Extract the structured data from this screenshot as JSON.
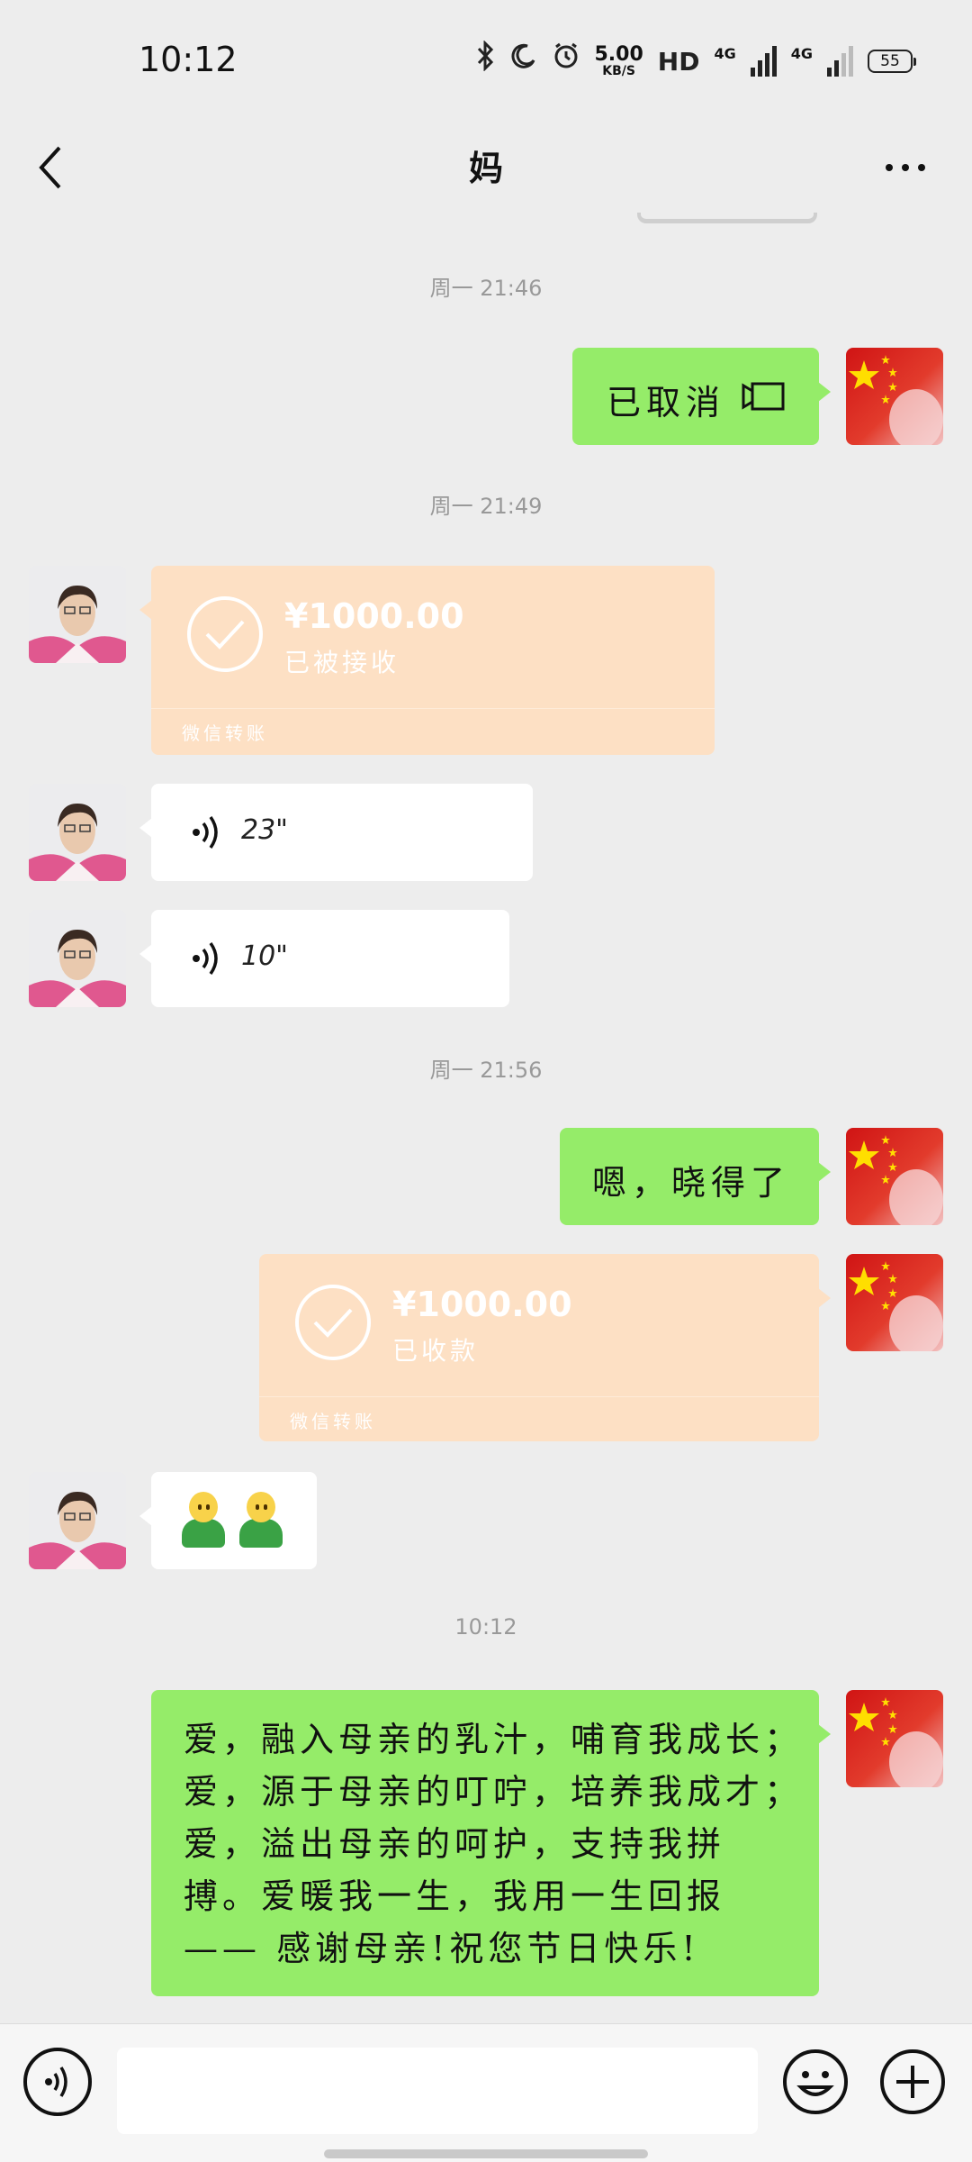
{
  "status_bar": {
    "time": "10:12",
    "speed_value": "5.00",
    "speed_unit": "KB/S",
    "hd_label": "HD",
    "net_label_1": "4G",
    "net_label_2": "4G",
    "battery": "55",
    "icons": [
      "bluetooth-icon",
      "moon-icon",
      "alarm-icon",
      "signal-icon",
      "battery-icon"
    ]
  },
  "header": {
    "title": "妈"
  },
  "messages": [
    {
      "type": "timestamp",
      "text": "周一 21:46"
    },
    {
      "type": "text",
      "side": "right",
      "text": "已取消",
      "icon": "video-call-icon"
    },
    {
      "type": "timestamp",
      "text": "周一 21:49"
    },
    {
      "type": "transfer",
      "side": "left",
      "amount": "¥1000.00",
      "status": "已被接收",
      "footer": "微信转账"
    },
    {
      "type": "voice",
      "side": "left",
      "duration": "23\""
    },
    {
      "type": "voice",
      "side": "left",
      "duration": "10\""
    },
    {
      "type": "timestamp",
      "text": "周一 21:56"
    },
    {
      "type": "text",
      "side": "right",
      "text": "嗯，晓得了"
    },
    {
      "type": "transfer",
      "side": "right",
      "amount": "¥1000.00",
      "status": "已收款",
      "footer": "微信转账"
    },
    {
      "type": "emoji",
      "side": "left",
      "emoji": [
        "person-emoji",
        "person-emoji"
      ]
    },
    {
      "type": "timestamp",
      "text": "10:12"
    },
    {
      "type": "text",
      "side": "right",
      "text": "爱，融入母亲的乳汁，哺育我成长；\n爱，源于母亲的叮咛，培养我成才；\n爱，溢出母亲的呵护，支持我拼\n搏。爱暖我一生，我用一生回报\n—— 感谢母亲!祝您节日快乐!"
    }
  ],
  "colors": {
    "background": "#ededed",
    "green_bubble": "#95ec69",
    "white_bubble": "#ffffff",
    "transfer_bubble": "#fde0c4"
  },
  "input_bar": {
    "placeholder": ""
  }
}
